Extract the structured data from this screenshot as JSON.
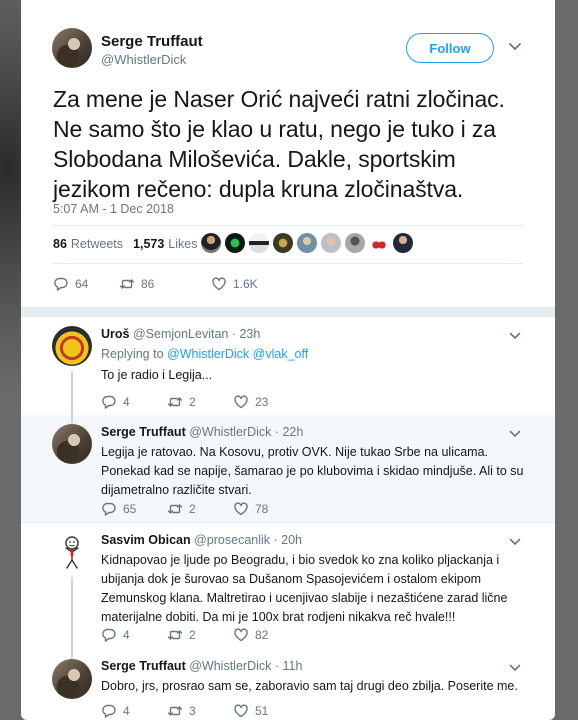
{
  "main_tweet": {
    "name": "Serge Truffaut",
    "handle": "@WhistlerDick",
    "follow_label": "Follow",
    "text": "Za mene je Naser Orić najveći ratni zločinac. Ne samo što je klao u ratu, nego je tuko i za Slobodana Miloševića. Dakle, sportskim jezikom rečeno: dupla kruna zločinaštva.",
    "timestamp": "5:07 AM - 1 Dec 2018",
    "retweets_count": "86",
    "retweets_label": "Retweets",
    "likes_count": "1,573",
    "likes_label": "Likes",
    "reply_count": "64",
    "retweet_count": "86",
    "like_count": "1.6K"
  },
  "replies": [
    {
      "name": "Uroš",
      "handle_time": "@SemjonLevitan · 23h",
      "replying_prefix": "Replying to",
      "replying_to_1": "@WhistlerDick",
      "replying_to_2": "@vlak_off",
      "text": "To je radio i Legija...",
      "reply_count": "4",
      "retweet_count": "2",
      "like_count": "23"
    },
    {
      "name": "Serge Truffaut",
      "handle_time": "@WhistlerDick · 22h",
      "text": "Legija je ratovao. Na Kosovu, protiv OVK. Nije tukao Srbe na ulicama. Ponekad kad se napije, šamarao je po klubovima i skidao mindjuše. Ali to su dijametralno različite stvari.",
      "reply_count": "65",
      "retweet_count": "2",
      "like_count": "78"
    },
    {
      "name": "Sasvim Obican",
      "handle_time": "@prosecanlik · 20h",
      "text": "Kidnapovao je ljude po Beogradu, i bio svedok ko zna koliko pljackanja i ubijanja dok je šurovao sa Dušanom Spasojevićem i ostalom ekipom Zemunskog klana. Maltretirao i ucenjivao slabije i nezaštićene zarad lične materijalne dobiti. Da mi je 100x brat rodjeni nikakva reč hvale!!!",
      "reply_count": "4",
      "retweet_count": "2",
      "like_count": "82"
    },
    {
      "name": "Serge Truffaut",
      "handle_time": "@WhistlerDick · 11h",
      "text": "Dobro, jrs, prosrao sam se, zaboravio sam taj drugi deo zbilja. Poserite me.",
      "reply_count": "4",
      "retweet_count": "3",
      "like_count": "51"
    }
  ],
  "icons": {
    "reply": "reply-icon",
    "retweet": "retweet-icon",
    "like": "heart-icon",
    "more": "chevron-down-icon"
  },
  "colors": {
    "accent": "#1da1f2",
    "muted": "#657786",
    "text": "#14171a",
    "thread_line": "#ccd6dd"
  }
}
